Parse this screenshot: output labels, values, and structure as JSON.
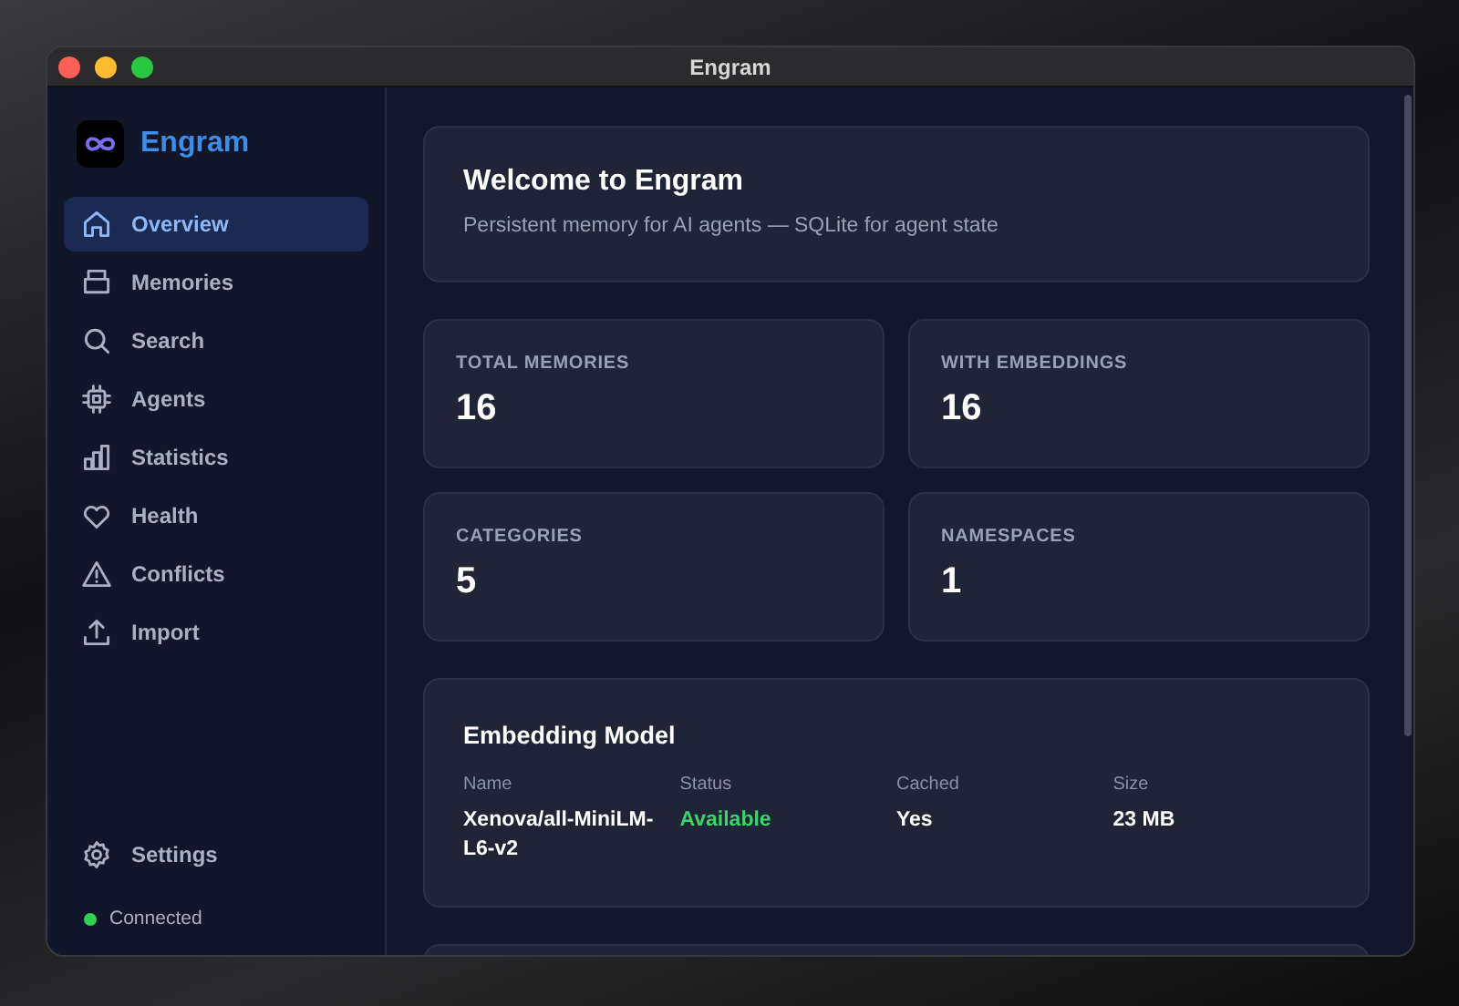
{
  "window": {
    "title": "Engram"
  },
  "sidebar": {
    "brand": "Engram",
    "items": [
      {
        "label": "Overview",
        "kind": "home",
        "selected": true
      },
      {
        "label": "Memories",
        "kind": "storage",
        "selected": false
      },
      {
        "label": "Search",
        "kind": "search",
        "selected": false
      },
      {
        "label": "Agents",
        "kind": "chip",
        "selected": false
      },
      {
        "label": "Statistics",
        "kind": "bars",
        "selected": false
      },
      {
        "label": "Health",
        "kind": "heart",
        "selected": false
      },
      {
        "label": "Conflicts",
        "kind": "warning",
        "selected": false
      },
      {
        "label": "Import",
        "kind": "upload",
        "selected": false
      }
    ],
    "settings": {
      "label": "Settings",
      "selected": false
    },
    "connection": {
      "label": "Connected",
      "connected": true
    }
  },
  "welcome": {
    "title": "Welcome to Engram",
    "subtitle": "Persistent memory for AI agents — SQLite for agent state"
  },
  "stats": [
    {
      "label": "TOTAL MEMORIES",
      "value": "16"
    },
    {
      "label": "WITH EMBEDDINGS",
      "value": "16"
    },
    {
      "label": "CATEGORIES",
      "value": "5"
    },
    {
      "label": "NAMESPACES",
      "value": "1"
    }
  ],
  "model": {
    "title": "Embedding Model",
    "fields": [
      {
        "label": "Name",
        "value": "Xenova/all-MiniLM-L6-v2",
        "kind": "text"
      },
      {
        "label": "Status",
        "value": "Available",
        "kind": "status"
      },
      {
        "label": "Cached",
        "value": "Yes",
        "kind": "text"
      },
      {
        "label": "Size",
        "value": "23 MB",
        "kind": "text"
      }
    ]
  }
}
